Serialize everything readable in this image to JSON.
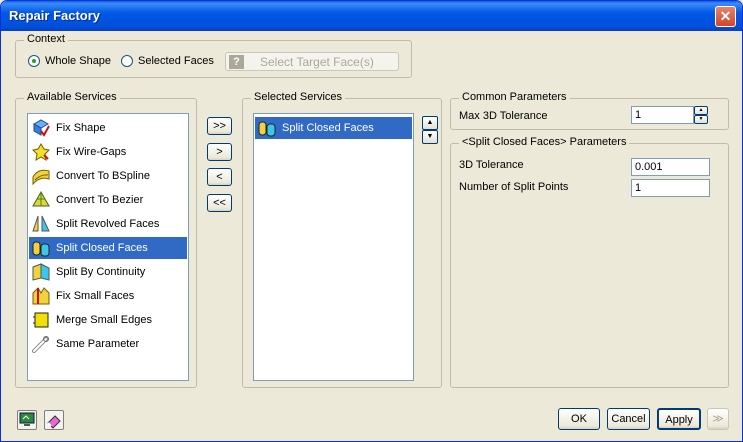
{
  "window": {
    "title": "Repair Factory",
    "close_glyph": "✕"
  },
  "context": {
    "legend": "Context",
    "options": [
      {
        "label": "Whole Shape",
        "selected": true
      },
      {
        "label": "Selected Faces",
        "selected": false
      }
    ],
    "target_button": {
      "label": "Select Target Face(s)",
      "icon": "question-icon",
      "q": "?"
    }
  },
  "available": {
    "legend": "Available Services",
    "items": [
      {
        "label": "Fix Shape",
        "icon": "fix-shape-icon"
      },
      {
        "label": "Fix Wire-Gaps",
        "icon": "fix-wire-gaps-icon"
      },
      {
        "label": "Convert To BSpline",
        "icon": "convert-bspline-icon"
      },
      {
        "label": "Convert To Bezier",
        "icon": "convert-bezier-icon"
      },
      {
        "label": "Split Revolved Faces",
        "icon": "split-revolved-icon"
      },
      {
        "label": "Split Closed Faces",
        "icon": "split-closed-icon",
        "selected": true
      },
      {
        "label": "Split By Continuity",
        "icon": "split-continuity-icon"
      },
      {
        "label": "Fix Small Faces",
        "icon": "fix-small-faces-icon"
      },
      {
        "label": "Merge Small Edges",
        "icon": "merge-edges-icon"
      },
      {
        "label": "Same Parameter",
        "icon": "same-parameter-icon"
      }
    ]
  },
  "transfer": {
    "add_all": ">>",
    "add": ">",
    "remove": "<",
    "remove_all": "<<"
  },
  "selected": {
    "legend": "Selected Services",
    "items": [
      {
        "label": "Split Closed Faces",
        "icon": "split-closed-icon",
        "selected": true
      }
    ],
    "up_glyph": "▲",
    "down_glyph": "▼"
  },
  "common": {
    "legend": "Common Parameters",
    "max_tol_label": "Max 3D Tolerance",
    "max_tol_value": "1"
  },
  "split_params": {
    "legend": "<Split Closed Faces> Parameters",
    "tol_label": "3D Tolerance",
    "tol_value": "0.001",
    "points_label": "Number of Split Points",
    "points_value": "1"
  },
  "footer": {
    "ok": "OK",
    "cancel": "Cancel",
    "apply": "Apply",
    "next_glyph": "≫",
    "tool1_icon": "monitor-icon",
    "tool2_icon": "eraser-icon"
  },
  "colors": {
    "title_bar": "#0058e6",
    "selection": "#316ac5",
    "dialog_bg": "#ece9d8"
  }
}
